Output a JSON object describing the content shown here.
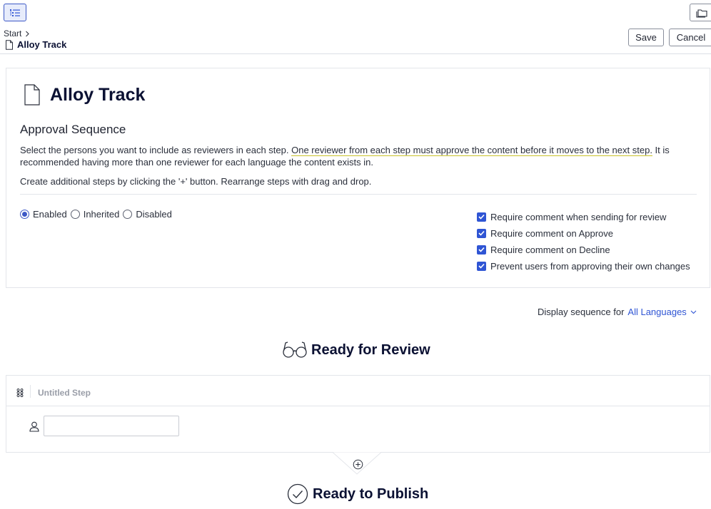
{
  "topbar": {
    "breadcrumb": {
      "root": "Start"
    },
    "title": "Alloy Track",
    "save_label": "Save",
    "cancel_label": "Cancel"
  },
  "card": {
    "title": "Alloy Track",
    "section_title": "Approval Sequence",
    "description_part1": "Select the persons you want to include as reviewers in each step. ",
    "description_highlight": "One reviewer from each step must approve the content before it moves to the next step.",
    "description_part2": " It is recommended having more than one reviewer for each language the content exists in.",
    "description2": "Create additional steps by clicking the '+' button. Rearrange steps with drag and drop.",
    "radios": [
      {
        "label": "Enabled",
        "selected": true
      },
      {
        "label": "Inherited",
        "selected": false
      },
      {
        "label": "Disabled",
        "selected": false
      }
    ],
    "checks": [
      {
        "label": "Require comment when sending for review",
        "checked": true
      },
      {
        "label": "Require comment on Approve",
        "checked": true
      },
      {
        "label": "Require comment on Decline",
        "checked": true
      },
      {
        "label": "Prevent users from approving their own changes",
        "checked": true
      }
    ]
  },
  "sequence": {
    "label": "Display sequence for",
    "language": "All Languages"
  },
  "stages": {
    "review": "Ready for Review",
    "publish": "Ready to Publish"
  },
  "step": {
    "name": "Untitled Step",
    "reviewer_value": ""
  },
  "colors": {
    "accent": "#2f55d4",
    "title": "#0b1133",
    "border": "#e3e5ea",
    "highlight_underline": "#c9c22a"
  },
  "icons": {
    "nav": "tree-list-icon",
    "folder": "folder-stack-icon",
    "page": "page-icon",
    "review": "glasses-icon",
    "publish": "check-circle-icon",
    "drag": "drag-handle-icon",
    "user": "user-icon",
    "add": "plus-circle-icon"
  }
}
